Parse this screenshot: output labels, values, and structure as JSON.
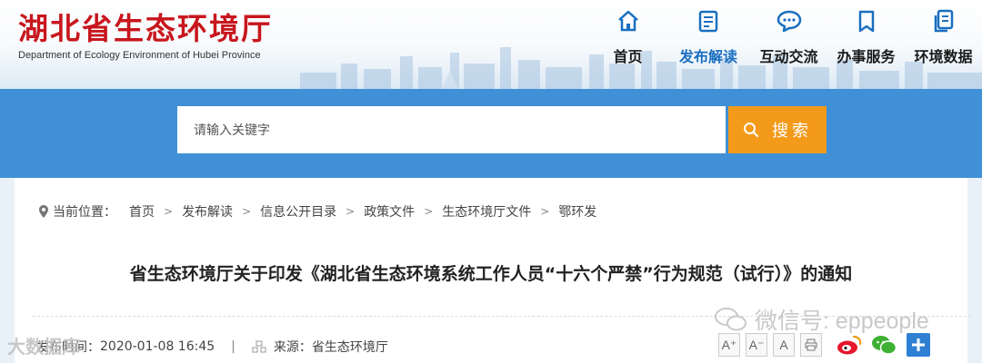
{
  "site": {
    "title": "湖北省生态环境厅",
    "subtitle": "Department of Ecology Environment of Hubei Province"
  },
  "nav": [
    {
      "label": "首页",
      "icon": "home-icon"
    },
    {
      "label": "发布解读",
      "icon": "document-icon",
      "active": true
    },
    {
      "label": "互动交流",
      "icon": "chat-bubble-icon"
    },
    {
      "label": "办事服务",
      "icon": "bookmark-icon"
    },
    {
      "label": "环境数据",
      "icon": "files-icon"
    }
  ],
  "search": {
    "placeholder": "请输入关键字",
    "button_label": "搜索"
  },
  "breadcrumb": {
    "location_label": "当前位置：",
    "items": [
      "首页",
      "发布解读",
      "信息公开目录",
      "政策文件",
      "生态环境厅文件",
      "鄂环发"
    ]
  },
  "article": {
    "title": "省生态环境厅关于印发《湖北省生态环境系统工作人员“十六个严禁”行为规范（试行）》的通知",
    "date_label": "发布时间：",
    "date": "2020-01-08 16:45",
    "source_label": "来源：",
    "source": "省生态环境厅"
  },
  "tools": {
    "font_large": "A⁺",
    "font_small": "A⁻",
    "font_normal": "A"
  },
  "watermark": {
    "text": "微信号: eppeople",
    "corner": "大数据库"
  },
  "colors": {
    "brand_red": "#c8161d",
    "nav_blue": "#1a6fc0",
    "band_blue": "#3f90d6",
    "search_orange": "#f39a1b"
  }
}
